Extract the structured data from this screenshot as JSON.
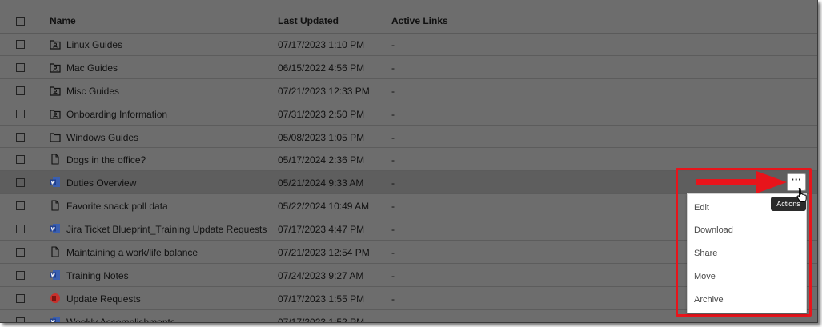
{
  "header": {
    "name_label": "Name",
    "updated_label": "Last Updated",
    "links_label": "Active Links"
  },
  "rows": [
    {
      "icon": "shared-folder-icon",
      "name": "Linux Guides",
      "date": "07/17/2023 1:10 PM",
      "links": "-"
    },
    {
      "icon": "shared-folder-icon",
      "name": "Mac Guides",
      "date": "06/15/2022 4:56 PM",
      "links": "-"
    },
    {
      "icon": "shared-folder-icon",
      "name": "Misc Guides",
      "date": "07/21/2023 12:33 PM",
      "links": "-"
    },
    {
      "icon": "shared-folder-icon",
      "name": "Onboarding Information",
      "date": "07/31/2023 2:50 PM",
      "links": "-"
    },
    {
      "icon": "folder-icon",
      "name": "Windows Guides",
      "date": "05/08/2023 1:05 PM",
      "links": "-"
    },
    {
      "icon": "document-icon",
      "name": "Dogs in the office?",
      "date": "05/17/2024 2:36 PM",
      "links": "-"
    },
    {
      "icon": "word-doc-icon",
      "name": "Duties Overview",
      "date": "05/21/2024 9:33 AM",
      "links": "-"
    },
    {
      "icon": "document-icon",
      "name": "Favorite snack poll data",
      "date": "05/22/2024 10:49 AM",
      "links": "-"
    },
    {
      "icon": "word-doc-icon",
      "name": "Jira Ticket Blueprint_Training Update Requests",
      "date": "07/17/2023 4:47 PM",
      "links": "-"
    },
    {
      "icon": "document-icon",
      "name": "Maintaining a work/life balance",
      "date": "07/21/2023 12:54 PM",
      "links": "-"
    },
    {
      "icon": "word-doc-icon",
      "name": "Training Notes",
      "date": "07/24/2023 9:27 AM",
      "links": "-"
    },
    {
      "icon": "office-doc-icon",
      "name": "Update Requests",
      "date": "07/17/2023 1:55 PM",
      "links": "-"
    },
    {
      "icon": "word-doc-icon",
      "name": "Weekly Accomplishments",
      "date": "07/17/2023 1:52 PM",
      "links": "-"
    }
  ],
  "highlighted_row": "Duties Overview",
  "actions": {
    "button_label": "···",
    "tooltip": "Actions",
    "menu": [
      "Edit",
      "Download",
      "Share",
      "Move",
      "Archive"
    ]
  },
  "colors": {
    "overlay": "#6d6d6d",
    "highlight": "#e8141b",
    "word_blue": "#1f3f8f",
    "office_red": "#c9302c"
  }
}
